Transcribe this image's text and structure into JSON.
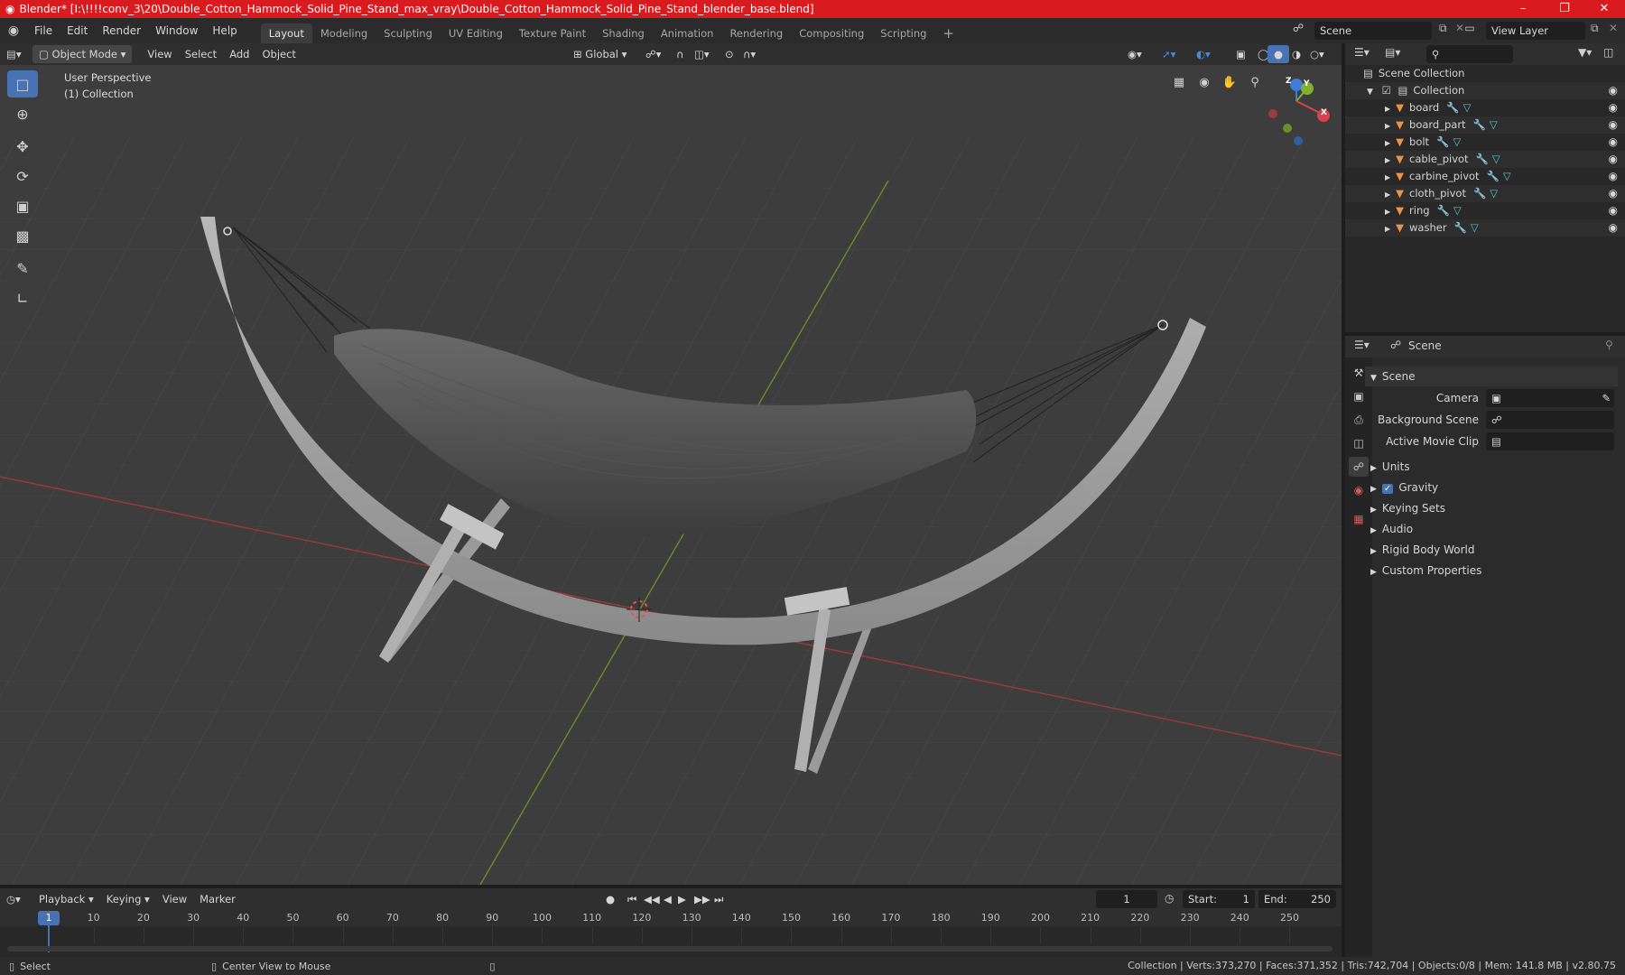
{
  "titlebar": {
    "title": "Blender* [I:\\!!!!conv_3\\20\\Double_Cotton_Hammock_Solid_Pine_Stand_max_vray\\Double_Cotton_Hammock_Solid_Pine_Stand_blender_base.blend]",
    "minimize": "–",
    "maximize": "❐",
    "close": "✕"
  },
  "menubar": {
    "items": [
      "File",
      "Edit",
      "Render",
      "Window",
      "Help"
    ],
    "workspaces": [
      "Layout",
      "Modeling",
      "Sculpting",
      "UV Editing",
      "Texture Paint",
      "Shading",
      "Animation",
      "Rendering",
      "Compositing",
      "Scripting"
    ],
    "add_tab": "+",
    "scene": "Scene",
    "view_layer": "View Layer"
  },
  "viewport_header": {
    "mode": "Object Mode",
    "menus": [
      "View",
      "Select",
      "Add",
      "Object"
    ],
    "orientation": "Global"
  },
  "viewport": {
    "perspective": "User Perspective",
    "collection": "(1) Collection",
    "gizmo": {
      "x": "X",
      "y": "Y",
      "z": "Z"
    }
  },
  "outliner": {
    "root": "Scene Collection",
    "collection": "Collection",
    "objects": [
      "board",
      "board_part",
      "bolt",
      "cable_pivot",
      "carbine_pivot",
      "cloth_pivot",
      "ring",
      "washer"
    ]
  },
  "properties": {
    "context": "Scene",
    "section": "Scene",
    "fields": [
      {
        "label": "Camera",
        "value": ""
      },
      {
        "label": "Background Scene",
        "value": ""
      },
      {
        "label": "Active Movie Clip",
        "value": ""
      }
    ],
    "panels": [
      "Units",
      "Gravity",
      "Keying Sets",
      "Audio",
      "Rigid Body World",
      "Custom Properties"
    ],
    "gravity_checked": true
  },
  "timeline": {
    "menus": [
      "Playback",
      "Keying",
      "View",
      "Marker"
    ],
    "current_frame": "1",
    "start_label": "Start:",
    "start": "1",
    "end_label": "End:",
    "end": "250",
    "ticks": [
      "10",
      "20",
      "30",
      "40",
      "50",
      "60",
      "70",
      "80",
      "90",
      "100",
      "110",
      "120",
      "130",
      "140",
      "150",
      "160",
      "170",
      "180",
      "190",
      "200",
      "210",
      "220",
      "230",
      "240",
      "250"
    ],
    "playhead": "1"
  },
  "statusbar": {
    "select": "Select",
    "center_view": "Center View to Mouse",
    "stats": "Collection | Verts:373,270 | Faces:371,352 | Tris:742,704 | Objects:0/8 | Mem: 141.8 MB | v2.80.75"
  },
  "colors": {
    "accent": "#4772b3",
    "titlebar": "#d91a1f",
    "x_axis": "#c8453e",
    "y_axis": "#7fa52a"
  }
}
